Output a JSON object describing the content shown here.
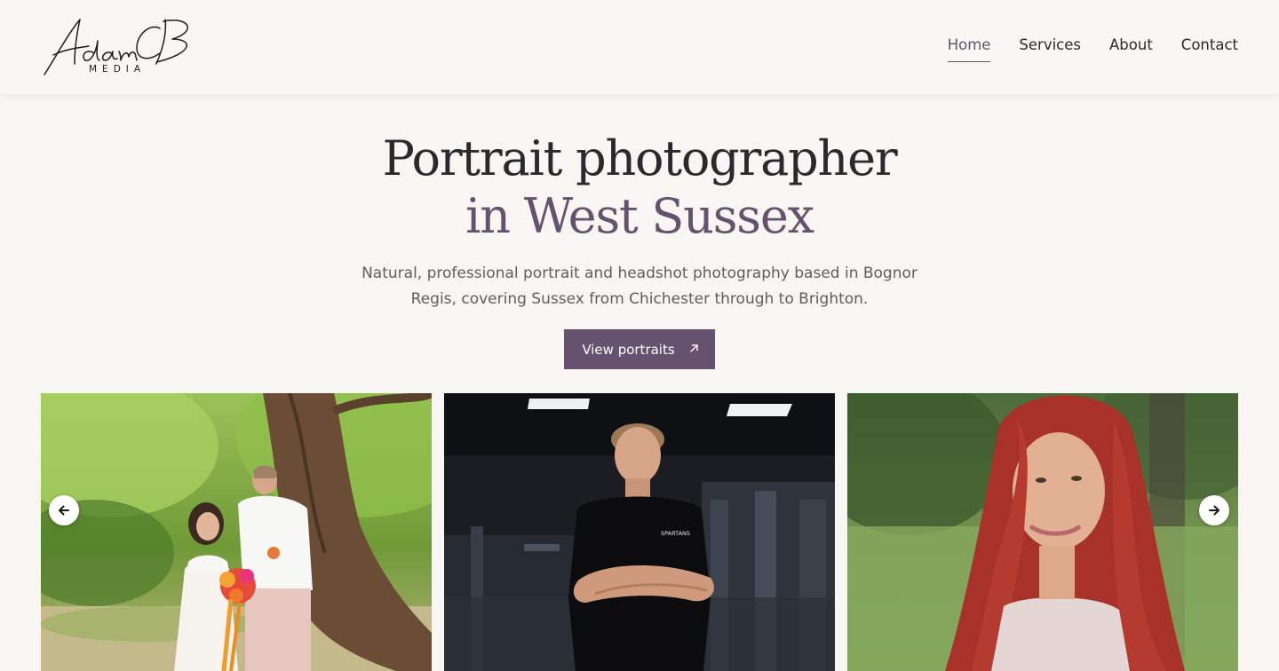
{
  "header": {
    "logo_script": "Adam CB",
    "logo_sub": "MEDIA",
    "nav": [
      {
        "label": "Home",
        "active": true
      },
      {
        "label": "Services",
        "active": false
      },
      {
        "label": "About",
        "active": false
      },
      {
        "label": "Contact",
        "active": false
      }
    ]
  },
  "hero": {
    "title_line1": "Portrait photographer",
    "title_line2": "in West Sussex",
    "subtitle": "Natural, professional portrait and headshot photography based in Bognor Regis, covering Sussex from Chichester through to Brighton.",
    "cta_label": "View portraits",
    "cta_icon": "arrow-up-right-icon"
  },
  "carousel": {
    "prev_icon": "arrow-left-icon",
    "next_icon": "arrow-right-icon",
    "slides": [
      {
        "subject": "wedding-couple-under-tree"
      },
      {
        "subject": "man-arms-crossed-in-gym",
        "shirt_text": "SPARTANS"
      },
      {
        "subject": "woman-with-red-hair-outdoors"
      }
    ]
  },
  "colors": {
    "accent": "#64526e",
    "background": "#f7f6f2",
    "text": "#2a2a2e",
    "muted_text": "#5e5e62"
  }
}
